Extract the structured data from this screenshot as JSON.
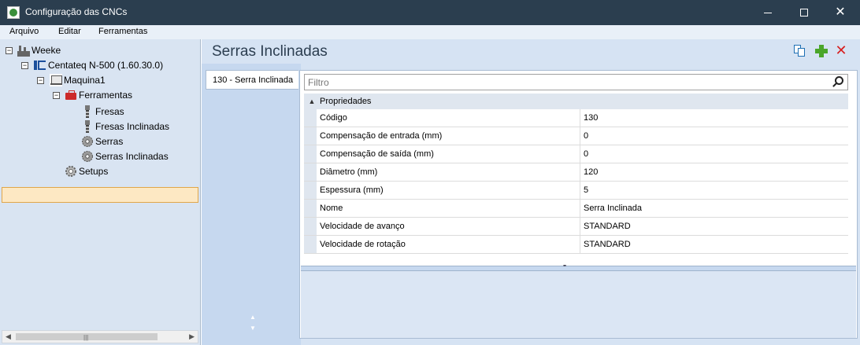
{
  "window": {
    "title": "Configuração das CNCs"
  },
  "menu": [
    "Arquivo",
    "Editar",
    "Ferramentas"
  ],
  "tree": {
    "root": "Weeke",
    "machine": "Centateq N-500 (1.60.30.0)",
    "machine_name": "Maquina1",
    "tools_group": "Ferramentas",
    "tools": [
      "Fresas",
      "Fresas Inclinadas",
      "Serras",
      "Serras Inclinadas"
    ],
    "setups": "Setups",
    "selected": "Serras Inclinadas"
  },
  "panel": {
    "title": "Serras Inclinadas",
    "tab_label": "130 - Serra Inclinada",
    "filter_placeholder": "Filtro",
    "category": "Propriedades",
    "properties": [
      {
        "name": "Código",
        "value": "130"
      },
      {
        "name": "Compensação de entrada (mm)",
        "value": "0"
      },
      {
        "name": "Compensação de saída (mm)",
        "value": "0"
      },
      {
        "name": "Diâmetro (mm)",
        "value": "120"
      },
      {
        "name": "Espessura (mm)",
        "value": "5"
      },
      {
        "name": "Nome",
        "value": "Serra Inclinada"
      },
      {
        "name": "Velocidade de avanço",
        "value": "STANDARD"
      },
      {
        "name": "Velocidade de rotação",
        "value": "STANDARD"
      }
    ]
  },
  "icons": {
    "app": "cnc-config-icon",
    "copy": "copy-icon",
    "add": "add-icon",
    "delete": "delete-icon",
    "search": "search-icon"
  },
  "colors": {
    "titlebar": "#2b3e4f",
    "selection": "#fde8c3",
    "selection_border": "#e0a64a",
    "add": "#4aa62a",
    "delete": "#d81f1f",
    "panel_bg": "#d6e3f3"
  }
}
